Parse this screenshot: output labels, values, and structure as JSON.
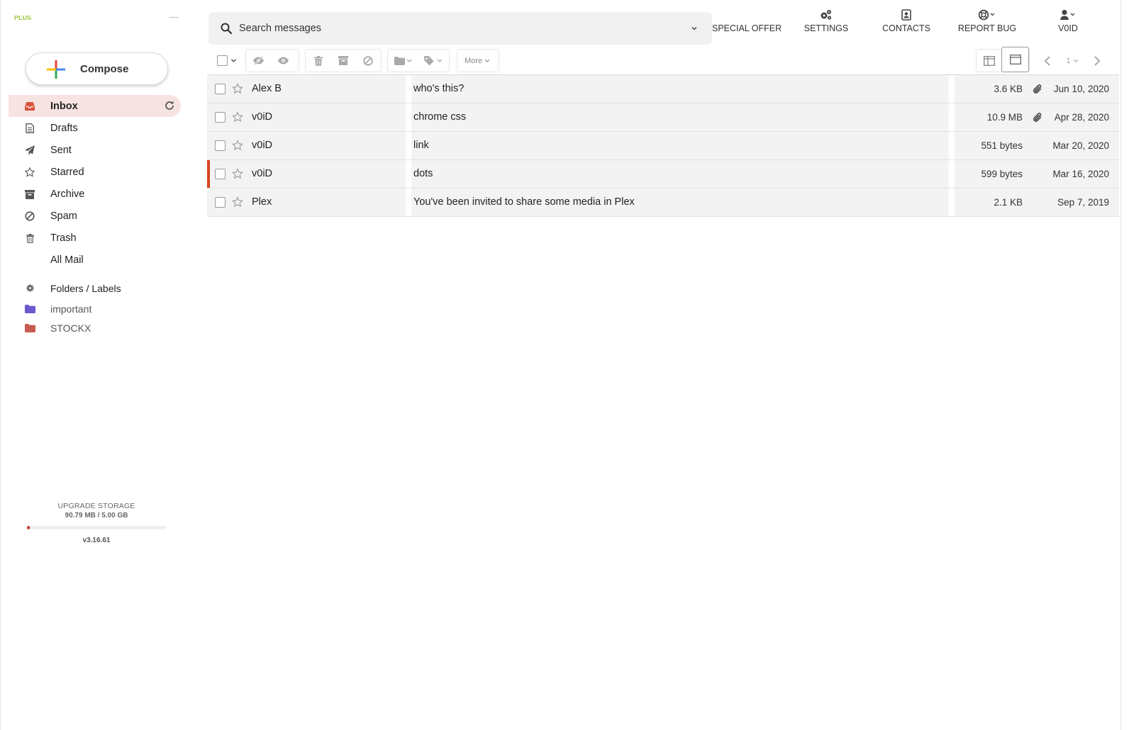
{
  "app": {
    "logo_text": "PLUS"
  },
  "compose": {
    "label": "Compose"
  },
  "nav": {
    "items": [
      {
        "label": "Inbox",
        "icon": "inbox-icon",
        "active": true
      },
      {
        "label": "Drafts",
        "icon": "drafts-icon"
      },
      {
        "label": "Sent",
        "icon": "sent-icon"
      },
      {
        "label": "Starred",
        "icon": "star-icon"
      },
      {
        "label": "Archive",
        "icon": "archive-icon"
      },
      {
        "label": "Spam",
        "icon": "spam-icon"
      },
      {
        "label": "Trash",
        "icon": "trash-icon"
      },
      {
        "label": "All Mail",
        "icon": ""
      }
    ]
  },
  "folders": {
    "header": "Folders / Labels",
    "items": [
      {
        "label": "important",
        "color": "#6a5acd"
      },
      {
        "label": "STOCKX",
        "color": "#c75b52"
      }
    ]
  },
  "storage": {
    "upgrade_label": "UPGRADE STORAGE",
    "usage": "90.79 MB / 5.00 GB",
    "used_fraction": 0.0177,
    "version": "v3.16.61"
  },
  "search": {
    "placeholder": "Search messages"
  },
  "topnav": {
    "special_offer": "SPECIAL OFFER",
    "settings": "SETTINGS",
    "contacts": "CONTACTS",
    "report_bug": "REPORT BUG",
    "user": "V0ID"
  },
  "toolbar": {
    "more_label": "More",
    "page": "1"
  },
  "messages": [
    {
      "from": "Alex B",
      "subject": "who's this?",
      "size": "3.6 KB",
      "attachment": true,
      "date": "Jun 10, 2020",
      "flagged": false
    },
    {
      "from": "v0iD",
      "subject": "chrome css",
      "size": "10.9 MB",
      "attachment": true,
      "date": "Apr 28, 2020",
      "flagged": false
    },
    {
      "from": "v0iD",
      "subject": "link",
      "size": "551 bytes",
      "attachment": false,
      "date": "Mar 20, 2020",
      "flagged": false
    },
    {
      "from": "v0iD",
      "subject": "dots",
      "size": "599 bytes",
      "attachment": false,
      "date": "Mar 16, 2020",
      "flagged": true
    },
    {
      "from": "Plex",
      "subject": "You've been invited to share some media in Plex",
      "size": "2.1 KB",
      "attachment": false,
      "date": "Sep 7, 2019",
      "flagged": false
    }
  ],
  "colors": {
    "accent": "#d9451e",
    "active_bg": "#f7e3e1",
    "row_bg": "#f3f3f3"
  }
}
